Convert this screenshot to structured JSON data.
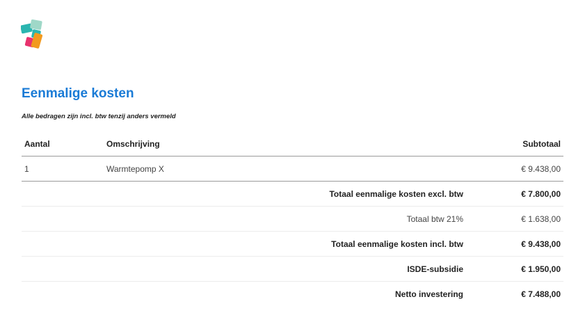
{
  "logo": {
    "name": "company-logo",
    "colors": [
      "#2bb5b0",
      "#9fd8c8",
      "#e8326e",
      "#f29a1f"
    ]
  },
  "title": "Eenmalige kosten",
  "note": "Alle bedragen zijn incl. btw tenzij anders vermeld",
  "table": {
    "headers": {
      "quantity": "Aantal",
      "description": "Omschrijving",
      "subtotal": "Subtotaal"
    },
    "items": [
      {
        "quantity": "1",
        "description": "Warmtepomp X",
        "subtotal": "€ 9.438,00"
      }
    ],
    "summary": [
      {
        "label": "Totaal eenmalige kosten excl. btw",
        "amount": "€ 7.800,00",
        "bold": true
      },
      {
        "label": "Totaal btw 21%",
        "amount": "€ 1.638,00",
        "bold": false
      },
      {
        "label": "Totaal eenmalige kosten incl. btw",
        "amount": "€ 9.438,00",
        "bold": true
      },
      {
        "label": "ISDE-subsidie",
        "amount": "€ 1.950,00",
        "bold": true
      },
      {
        "label": "Netto investering",
        "amount": "€ 7.488,00",
        "bold": true
      }
    ]
  }
}
